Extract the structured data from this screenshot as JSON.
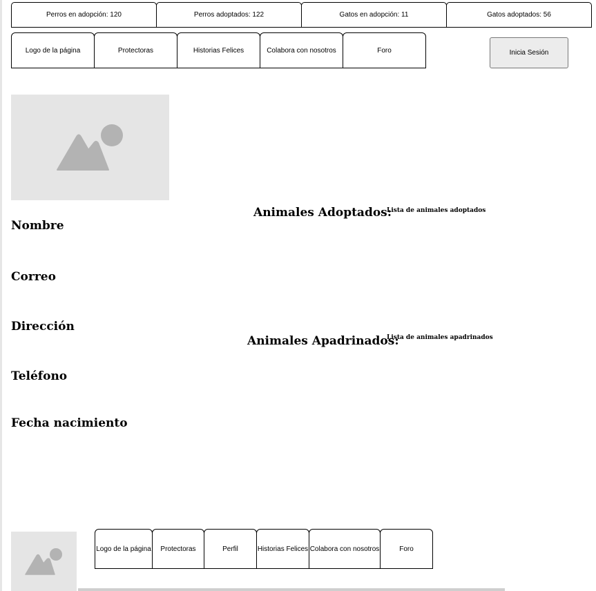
{
  "stats": [
    {
      "label": "Perros en adopción: 120"
    },
    {
      "label": "Perros adoptados: 122"
    },
    {
      "label": "Gatos en adopción: 11"
    },
    {
      "label": "Gatos adoptados: 56"
    }
  ],
  "nav": {
    "items": [
      {
        "label": "Logo de la página"
      },
      {
        "label": "Protectoras"
      },
      {
        "label": "Historias Felices"
      },
      {
        "label": "Colabora con nosotros"
      },
      {
        "label": "Foro"
      }
    ],
    "login_label": "Inicia Sesión"
  },
  "profile": {
    "fields": [
      {
        "label": "Nombre"
      },
      {
        "label": "Correo"
      },
      {
        "label": "Dirección"
      },
      {
        "label": "Teléfono"
      },
      {
        "label": "Fecha nacimiento"
      }
    ]
  },
  "sections": {
    "adopted": {
      "title": "Animales Adoptados:",
      "list": "Lista de animales adoptados"
    },
    "sponsored": {
      "title": "Animales Apadrinados:",
      "list": "Lista de animales apadrinados"
    }
  },
  "footer": {
    "items": [
      {
        "label": "Logo de la página"
      },
      {
        "label": "Protectoras"
      },
      {
        "label": "Perfil"
      },
      {
        "label": "Historias Felices"
      },
      {
        "label": "Colabora con nosotros"
      },
      {
        "label": "Foro"
      }
    ]
  },
  "icons": {
    "image_placeholder": "image-icon"
  },
  "colors": {
    "placeholder_bg": "#e5e5e5",
    "placeholder_icon": "#b3b3b3",
    "button_bg": "#ececec"
  }
}
